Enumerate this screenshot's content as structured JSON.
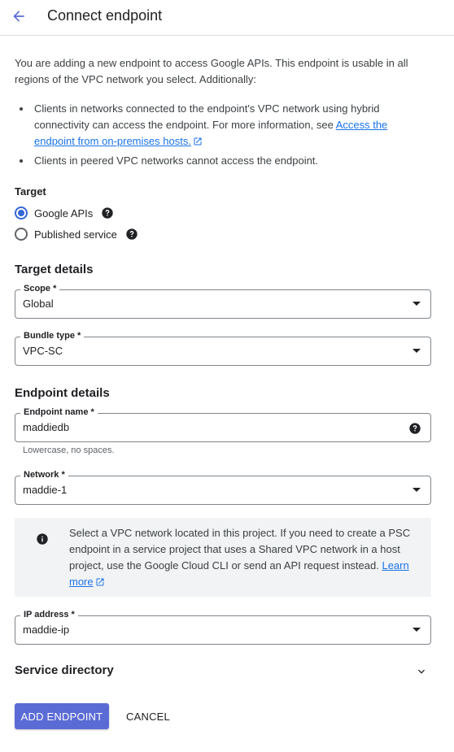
{
  "header": {
    "title": "Connect endpoint",
    "back_icon": "arrow-back-icon"
  },
  "intro": {
    "text": "You are adding a new endpoint to access Google APIs. This endpoint is usable in all regions of the VPC network you select. Additionally:",
    "bullets": [
      {
        "text": "Clients in networks connected to the endpoint's VPC network using hybrid connectivity can access the endpoint. For more information, see ",
        "link": "Access the endpoint from on-premises hosts."
      },
      {
        "text": "Clients in peered VPC networks cannot access the endpoint."
      }
    ]
  },
  "target": {
    "label": "Target",
    "options": [
      {
        "label": "Google APIs",
        "selected": true
      },
      {
        "label": "Published service",
        "selected": false
      }
    ]
  },
  "target_details": {
    "title": "Target details",
    "scope": {
      "label": "Scope *",
      "value": "Global"
    },
    "bundle_type": {
      "label": "Bundle type *",
      "value": "VPC-SC"
    }
  },
  "endpoint_details": {
    "title": "Endpoint details",
    "endpoint_name": {
      "label": "Endpoint name *",
      "value": "maddiedb",
      "hint": "Lowercase, no spaces."
    },
    "network": {
      "label": "Network *",
      "value": "maddie-1"
    },
    "info": {
      "text": "Select a VPC network located in this project. If you need to create a PSC endpoint in a service project that uses a Shared VPC network in a host project, use the Google Cloud CLI or send an API request instead. ",
      "link": "Learn more"
    },
    "ip_address": {
      "label": "IP address *",
      "value": "maddie-ip"
    }
  },
  "service_directory": {
    "label": "Service directory"
  },
  "actions": {
    "primary": "ADD ENDPOINT",
    "secondary": "CANCEL"
  },
  "colors": {
    "accent": "#3367d6",
    "primary_button": "#5b6bd5",
    "link": "#1a73e8"
  }
}
